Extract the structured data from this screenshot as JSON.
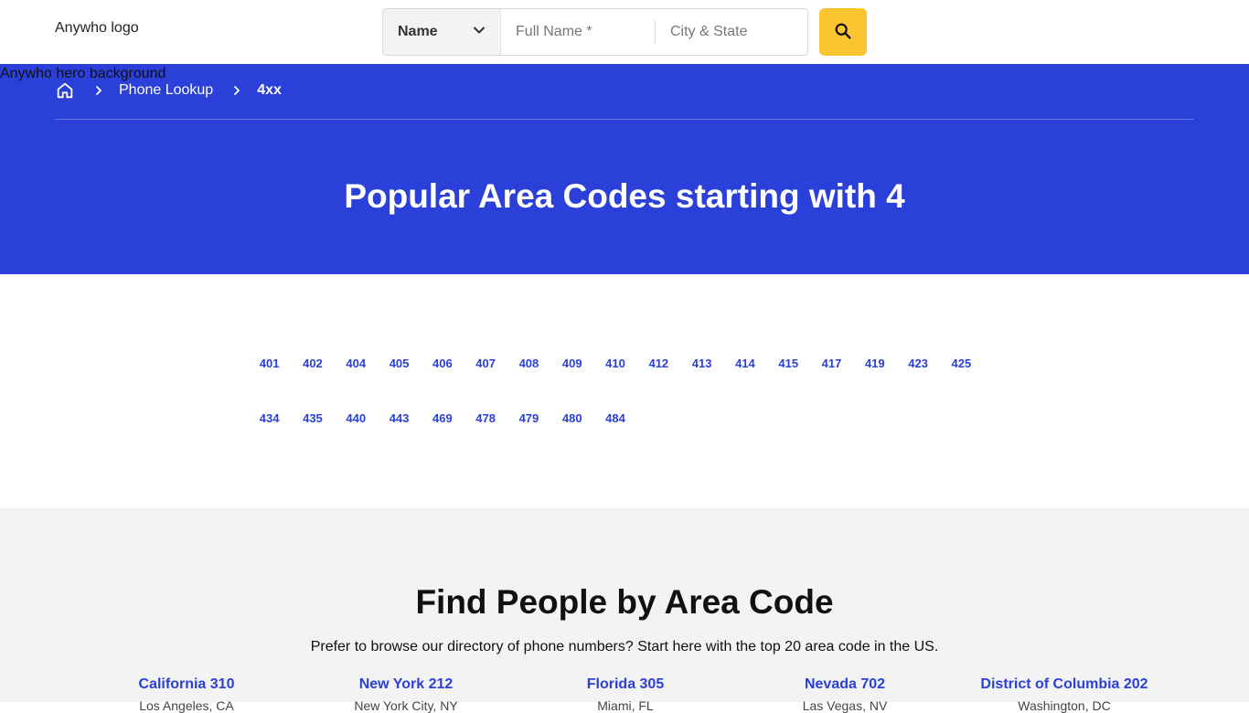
{
  "header": {
    "logo_alt": "Anywho logo",
    "search_type": "Name",
    "name_placeholder": "Full Name *",
    "city_placeholder": "City & State",
    "search_icon": "search-icon",
    "accent_color": "#fbc531"
  },
  "hero": {
    "background_alt": "Anywho hero background",
    "background_color": "#2b40d8",
    "breadcrumb": {
      "home_icon": "home-icon",
      "items": [
        {
          "label": "Phone Lookup"
        },
        {
          "label": "4xx"
        }
      ]
    },
    "title": "Popular Area Codes starting with 4"
  },
  "area_codes": {
    "rows": [
      [
        "401",
        "402",
        "404",
        "405",
        "406",
        "407",
        "408",
        "409",
        "410",
        "412",
        "413",
        "414",
        "415",
        "417",
        "419",
        "423",
        "425"
      ],
      [
        "434",
        "435",
        "440",
        "443",
        "469",
        "478",
        "479",
        "480",
        "484"
      ]
    ],
    "link_color": "#2b40d8"
  },
  "find_people": {
    "title": "Find People by Area Code",
    "subtitle": "Prefer to browse our directory of phone numbers? Start here with the top 20 area code in the US.",
    "states": [
      {
        "label": "California 310",
        "city": "Los Angeles, CA"
      },
      {
        "label": "New York 212",
        "city": "New York City, NY"
      },
      {
        "label": "Florida 305",
        "city": "Miami, FL"
      },
      {
        "label": "Nevada 702",
        "city": "Las Vegas, NV"
      },
      {
        "label": "District of Columbia 202",
        "city": "Washington, DC"
      }
    ]
  }
}
